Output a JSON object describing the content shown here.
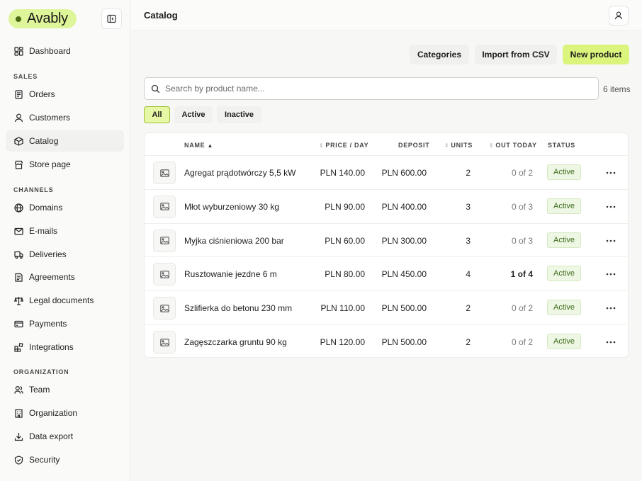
{
  "brand": {
    "name": "Avably"
  },
  "header": {
    "title": "Catalog"
  },
  "sidebar": {
    "main": [
      {
        "label": "Dashboard"
      }
    ],
    "sales_heading": "SALES",
    "sales": [
      {
        "label": "Orders"
      },
      {
        "label": "Customers"
      },
      {
        "label": "Catalog",
        "active": true
      },
      {
        "label": "Store page"
      }
    ],
    "channels_heading": "CHANNELS",
    "channels": [
      {
        "label": "Domains"
      },
      {
        "label": "E-mails"
      },
      {
        "label": "Deliveries"
      },
      {
        "label": "Agreements"
      },
      {
        "label": "Legal documents"
      },
      {
        "label": "Payments"
      },
      {
        "label": "Integrations"
      }
    ],
    "organization_heading": "ORGANIZATION",
    "organization": [
      {
        "label": "Team"
      },
      {
        "label": "Organization"
      },
      {
        "label": "Data export"
      },
      {
        "label": "Security"
      }
    ]
  },
  "actions": {
    "categories": "Categories",
    "import": "Import from CSV",
    "new_product": "New product"
  },
  "search": {
    "placeholder": "Search by product name...",
    "value": ""
  },
  "items_count": "6 items",
  "filters": [
    {
      "label": "All",
      "selected": true
    },
    {
      "label": "Active"
    },
    {
      "label": "Inactive"
    }
  ],
  "table": {
    "columns": {
      "name": "NAME",
      "price": "PRICE / DAY",
      "deposit": "DEPOSIT",
      "units": "UNITS",
      "out_today": "OUT TODAY",
      "status": "STATUS"
    },
    "rows": [
      {
        "name": "Agregat prądotwórczy 5,5 kW",
        "price": "PLN 140.00",
        "deposit": "PLN 600.00",
        "units": "2",
        "out_today": "0 of 2",
        "status": "Active"
      },
      {
        "name": "Młot wyburzeniowy 30 kg",
        "price": "PLN 90.00",
        "deposit": "PLN 400.00",
        "units": "3",
        "out_today": "0 of 3",
        "status": "Active"
      },
      {
        "name": "Myjka ciśnieniowa 200 bar",
        "price": "PLN 60.00",
        "deposit": "PLN 300.00",
        "units": "3",
        "out_today": "0 of 3",
        "status": "Active"
      },
      {
        "name": "Rusztowanie jezdne 6 m",
        "price": "PLN 80.00",
        "deposit": "PLN 450.00",
        "units": "4",
        "out_today": "1 of 4",
        "status": "Active",
        "out_highlight": true
      },
      {
        "name": "Szlifierka do betonu 230 mm",
        "price": "PLN 110.00",
        "deposit": "PLN 500.00",
        "units": "2",
        "out_today": "0 of 2",
        "status": "Active"
      },
      {
        "name": "Zagęszczarka gruntu 90 kg",
        "price": "PLN 120.00",
        "deposit": "PLN 500.00",
        "units": "2",
        "out_today": "0 of 2",
        "status": "Active"
      }
    ]
  }
}
